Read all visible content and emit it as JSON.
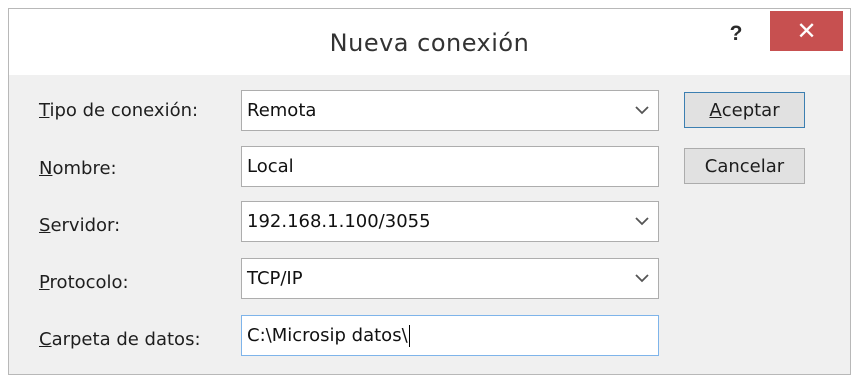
{
  "window": {
    "title": "Nueva conexión",
    "help_label": "?",
    "close_label": "✕"
  },
  "form": {
    "tipo": {
      "label_ul": "T",
      "label_rest": "ipo de conexión:",
      "value": "Remota"
    },
    "nombre": {
      "label_ul": "N",
      "label_rest": "ombre:",
      "value": "Local"
    },
    "servidor": {
      "label_ul": "S",
      "label_rest": "ervidor:",
      "value": "192.168.1.100/3055"
    },
    "protocolo": {
      "label_ul": "P",
      "label_rest": "rotocolo:",
      "value": "TCP/IP"
    },
    "carpeta": {
      "label_ul": "C",
      "label_rest": "arpeta de datos:",
      "value": "C:\\Microsip datos\\"
    }
  },
  "buttons": {
    "aceptar": {
      "ul": "A",
      "rest": "ceptar"
    },
    "cancelar": {
      "label": "Cancelar"
    }
  },
  "icons": {
    "dropdown": "chevron-down-icon",
    "close": "close-icon",
    "help": "help-icon"
  },
  "colors": {
    "close_button": "#c75050",
    "focus_border": "#7eb4ea",
    "default_button_border": "#3c7fb1"
  }
}
